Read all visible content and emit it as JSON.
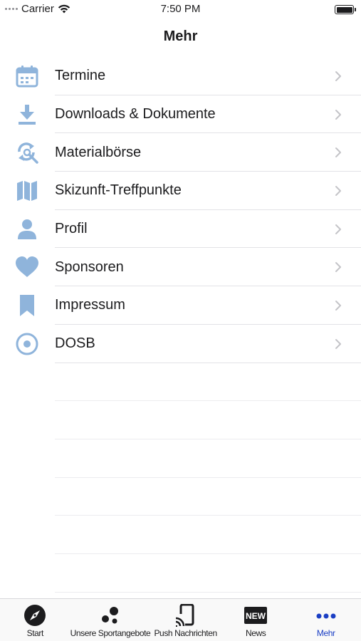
{
  "status_bar": {
    "carrier": "Carrier",
    "time": "7:50 PM"
  },
  "nav": {
    "title": "Mehr"
  },
  "colors": {
    "icon_blue": "#8fb4db",
    "chevron": "#c4c4c8",
    "active_tab": "#1b3fc4"
  },
  "menu": {
    "items": [
      {
        "label": "Termine",
        "icon": "calendar-icon"
      },
      {
        "label": "Downloads & Dokumente",
        "icon": "download-icon"
      },
      {
        "label": "Materialbörse",
        "icon": "refresh-search-icon"
      },
      {
        "label": "Skizunft-Treffpunkte",
        "icon": "map-icon"
      },
      {
        "label": "Profil",
        "icon": "person-icon"
      },
      {
        "label": "Sponsoren",
        "icon": "heart-icon"
      },
      {
        "label": "Impressum",
        "icon": "bookmark-icon"
      },
      {
        "label": "DOSB",
        "icon": "target-icon"
      }
    ]
  },
  "tab_bar": {
    "tabs": [
      {
        "label": "Start",
        "icon": "compass-icon",
        "active": false
      },
      {
        "label": "Unsere Sportangebote",
        "icon": "dots-cluster-icon",
        "active": false
      },
      {
        "label": "Push Nachrichten",
        "icon": "cast-icon",
        "active": false
      },
      {
        "label": "News",
        "icon": "new-badge-icon",
        "badge_text": "NEW",
        "active": false
      },
      {
        "label": "Mehr",
        "icon": "more-dots-icon",
        "active": true
      }
    ]
  }
}
